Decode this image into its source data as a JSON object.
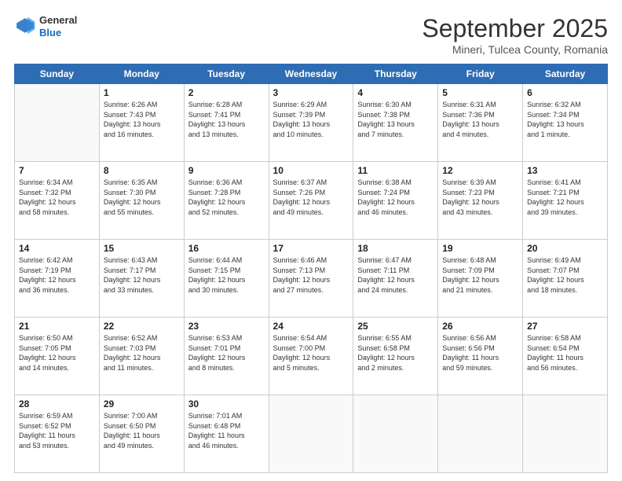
{
  "header": {
    "logo": {
      "general": "General",
      "blue": "Blue"
    },
    "title": "September 2025",
    "subtitle": "Mineri, Tulcea County, Romania"
  },
  "weekdays": [
    "Sunday",
    "Monday",
    "Tuesday",
    "Wednesday",
    "Thursday",
    "Friday",
    "Saturday"
  ],
  "weeks": [
    [
      {
        "day": "",
        "info": ""
      },
      {
        "day": "1",
        "info": "Sunrise: 6:26 AM\nSunset: 7:43 PM\nDaylight: 13 hours\nand 16 minutes."
      },
      {
        "day": "2",
        "info": "Sunrise: 6:28 AM\nSunset: 7:41 PM\nDaylight: 13 hours\nand 13 minutes."
      },
      {
        "day": "3",
        "info": "Sunrise: 6:29 AM\nSunset: 7:39 PM\nDaylight: 13 hours\nand 10 minutes."
      },
      {
        "day": "4",
        "info": "Sunrise: 6:30 AM\nSunset: 7:38 PM\nDaylight: 13 hours\nand 7 minutes."
      },
      {
        "day": "5",
        "info": "Sunrise: 6:31 AM\nSunset: 7:36 PM\nDaylight: 13 hours\nand 4 minutes."
      },
      {
        "day": "6",
        "info": "Sunrise: 6:32 AM\nSunset: 7:34 PM\nDaylight: 13 hours\nand 1 minute."
      }
    ],
    [
      {
        "day": "7",
        "info": "Sunrise: 6:34 AM\nSunset: 7:32 PM\nDaylight: 12 hours\nand 58 minutes."
      },
      {
        "day": "8",
        "info": "Sunrise: 6:35 AM\nSunset: 7:30 PM\nDaylight: 12 hours\nand 55 minutes."
      },
      {
        "day": "9",
        "info": "Sunrise: 6:36 AM\nSunset: 7:28 PM\nDaylight: 12 hours\nand 52 minutes."
      },
      {
        "day": "10",
        "info": "Sunrise: 6:37 AM\nSunset: 7:26 PM\nDaylight: 12 hours\nand 49 minutes."
      },
      {
        "day": "11",
        "info": "Sunrise: 6:38 AM\nSunset: 7:24 PM\nDaylight: 12 hours\nand 46 minutes."
      },
      {
        "day": "12",
        "info": "Sunrise: 6:39 AM\nSunset: 7:23 PM\nDaylight: 12 hours\nand 43 minutes."
      },
      {
        "day": "13",
        "info": "Sunrise: 6:41 AM\nSunset: 7:21 PM\nDaylight: 12 hours\nand 39 minutes."
      }
    ],
    [
      {
        "day": "14",
        "info": "Sunrise: 6:42 AM\nSunset: 7:19 PM\nDaylight: 12 hours\nand 36 minutes."
      },
      {
        "day": "15",
        "info": "Sunrise: 6:43 AM\nSunset: 7:17 PM\nDaylight: 12 hours\nand 33 minutes."
      },
      {
        "day": "16",
        "info": "Sunrise: 6:44 AM\nSunset: 7:15 PM\nDaylight: 12 hours\nand 30 minutes."
      },
      {
        "day": "17",
        "info": "Sunrise: 6:46 AM\nSunset: 7:13 PM\nDaylight: 12 hours\nand 27 minutes."
      },
      {
        "day": "18",
        "info": "Sunrise: 6:47 AM\nSunset: 7:11 PM\nDaylight: 12 hours\nand 24 minutes."
      },
      {
        "day": "19",
        "info": "Sunrise: 6:48 AM\nSunset: 7:09 PM\nDaylight: 12 hours\nand 21 minutes."
      },
      {
        "day": "20",
        "info": "Sunrise: 6:49 AM\nSunset: 7:07 PM\nDaylight: 12 hours\nand 18 minutes."
      }
    ],
    [
      {
        "day": "21",
        "info": "Sunrise: 6:50 AM\nSunset: 7:05 PM\nDaylight: 12 hours\nand 14 minutes."
      },
      {
        "day": "22",
        "info": "Sunrise: 6:52 AM\nSunset: 7:03 PM\nDaylight: 12 hours\nand 11 minutes."
      },
      {
        "day": "23",
        "info": "Sunrise: 6:53 AM\nSunset: 7:01 PM\nDaylight: 12 hours\nand 8 minutes."
      },
      {
        "day": "24",
        "info": "Sunrise: 6:54 AM\nSunset: 7:00 PM\nDaylight: 12 hours\nand 5 minutes."
      },
      {
        "day": "25",
        "info": "Sunrise: 6:55 AM\nSunset: 6:58 PM\nDaylight: 12 hours\nand 2 minutes."
      },
      {
        "day": "26",
        "info": "Sunrise: 6:56 AM\nSunset: 6:56 PM\nDaylight: 11 hours\nand 59 minutes."
      },
      {
        "day": "27",
        "info": "Sunrise: 6:58 AM\nSunset: 6:54 PM\nDaylight: 11 hours\nand 56 minutes."
      }
    ],
    [
      {
        "day": "28",
        "info": "Sunrise: 6:59 AM\nSunset: 6:52 PM\nDaylight: 11 hours\nand 53 minutes."
      },
      {
        "day": "29",
        "info": "Sunrise: 7:00 AM\nSunset: 6:50 PM\nDaylight: 11 hours\nand 49 minutes."
      },
      {
        "day": "30",
        "info": "Sunrise: 7:01 AM\nSunset: 6:48 PM\nDaylight: 11 hours\nand 46 minutes."
      },
      {
        "day": "",
        "info": ""
      },
      {
        "day": "",
        "info": ""
      },
      {
        "day": "",
        "info": ""
      },
      {
        "day": "",
        "info": ""
      }
    ]
  ]
}
